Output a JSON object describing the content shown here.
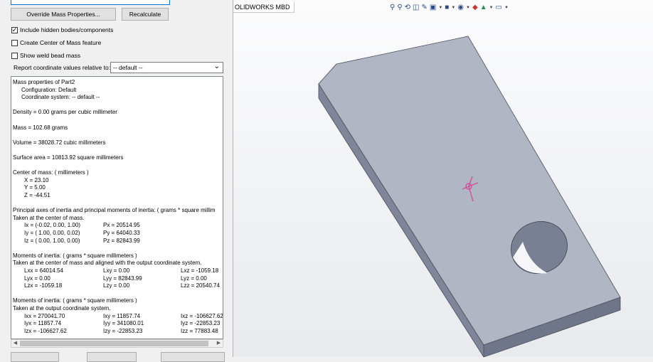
{
  "buttons": {
    "override": "Override Mass Properties...",
    "recalculate": "Recalculate"
  },
  "options": {
    "include_hidden": {
      "label": "Include hidden bodies/components",
      "checked": true
    },
    "create_com": {
      "label": "Create Center of Mass feature",
      "checked": false
    },
    "show_weld": {
      "label": "Show weld bead mass",
      "checked": false
    }
  },
  "report_coord": {
    "label": "Report coordinate values relative to:",
    "value": "-- default --"
  },
  "report_lines": [
    {
      "text": "Mass properties of Part2"
    },
    {
      "text": "Configuration: Default",
      "indent": 12
    },
    {
      "text": "Coordinate system: -- default --",
      "indent": 12
    },
    {
      "text": ""
    },
    {
      "text": "Density = 0.00 grams per cubic millimeter"
    },
    {
      "text": ""
    },
    {
      "text": "Mass = 102.68 grams"
    },
    {
      "text": ""
    },
    {
      "text": "Volume = 38028.72 cubic millimeters"
    },
    {
      "text": ""
    },
    {
      "text": "Surface area = 10813.92  square millimeters"
    },
    {
      "text": ""
    },
    {
      "text": "Center of mass: ( millimeters )"
    },
    {
      "text": "X = 23.10",
      "indent": 16
    },
    {
      "text": "Y = 5.00",
      "indent": 16
    },
    {
      "text": "Z = -44.51",
      "indent": 16
    },
    {
      "text": ""
    },
    {
      "text": "Principal axes of inertia and principal moments of inertia: ( grams *  square millim"
    },
    {
      "text": "Taken at the center of mass."
    },
    {
      "text": "Ix = (-0.02,  0.00,  1.00)",
      "indent": 16,
      "col2": "Px = 20514.95"
    },
    {
      "text": "Iy = ( 1.00,  0.00,  0.02)",
      "indent": 16,
      "col2": "Py = 64040.33"
    },
    {
      "text": "Iz = ( 0.00,  1.00,  0.00)",
      "indent": 16,
      "col2": "Pz = 82843.99"
    },
    {
      "text": ""
    },
    {
      "text": "Moments of inertia: ( grams *  square millimeters )"
    },
    {
      "text": "Taken at the center of mass and aligned with the output coordinate system."
    },
    {
      "text": "Lxx = 64014.54",
      "indent": 16,
      "col2": "Lxy = 0.00",
      "col3": "Lxz = -1059.18"
    },
    {
      "text": "Lyx = 0.00",
      "indent": 16,
      "col2": "Lyy = 82843.99",
      "col3": "Lyz = 0.00"
    },
    {
      "text": "Lzx = -1059.18",
      "indent": 16,
      "col2": "Lzy = 0.00",
      "col3": "Lzz = 20540.74"
    },
    {
      "text": ""
    },
    {
      "text": "Moments of inertia: ( grams *  square millimeters )"
    },
    {
      "text": "Taken at the output coordinate system."
    },
    {
      "text": "Ixx = 270041.70",
      "indent": 16,
      "col2": "Ixy = 11857.74",
      "col3": "Ixz = -106627.62"
    },
    {
      "text": "Iyx = 11857.74",
      "indent": 16,
      "col2": "Iyy = 341080.01",
      "col3": "Iyz = -22853.23"
    },
    {
      "text": "Izx = -106627.62",
      "indent": 16,
      "col2": "Izy = -22853.23",
      "col3": "Izz = 77883.48"
    }
  ],
  "viewport": {
    "tab_label": "OLIDWORKS MBD",
    "toolbar_icons": [
      "zoom-to-fit-icon",
      "zoom-area-icon",
      "previous-view-icon",
      "section-view-icon",
      "dynamic-annotation-icon",
      "view-orientation-icon",
      "display-style-icon",
      "hide-show-icon",
      "edit-appearance-icon",
      "apply-scene-icon",
      "view-settings-icon"
    ]
  },
  "colors": {
    "panel_bg": "#f0f0f0",
    "part_top": "#a9aebd",
    "part_side": "#8d93a6",
    "com_marker": "#d0509a"
  }
}
